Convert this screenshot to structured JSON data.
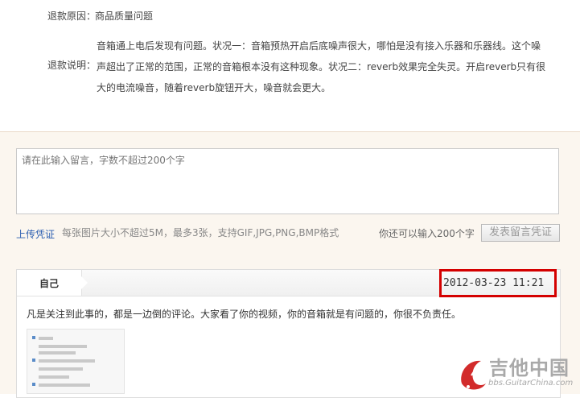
{
  "refund": {
    "reason_label": "退款原因：",
    "reason_value": "商品质量问题",
    "desc_label": "退款说明：",
    "desc_text": "音箱通上电后发现有问题。状况一：音箱预热开启后底噪声很大，哪怕是没有接入乐器和乐器线。这个噪声超出了正常的范围，正常的音箱根本没有这种现象。状况二：reverb效果完全失灵。开启reverb只有很大的电流噪音，随着reverb旋钮开大，噪音就会更大。"
  },
  "message": {
    "placeholder": "请在此输入留言，字数不超过200个字",
    "upload_link": "上传凭证",
    "upload_hint": "每张图片大小不超过5M，最多3张，支持GIF,JPG,PNG,BMP格式",
    "remaining": "你还可以输入200个字",
    "submit_label": "发表留言凭证"
  },
  "comment": {
    "author": "自己",
    "timestamp": "2012-03-23  11:21",
    "text": "凡是关注到此事的，都是一边倒的评论。大家看了你的视频，你的音箱就是有问题的，你很不负责任。"
  },
  "watermark": {
    "title": "吉他中国",
    "site": "bbs.GuitarChina.com"
  },
  "colors": {
    "highlight": "#d40000",
    "link": "#2a5db0",
    "panel_bg": "#fbf6ef"
  }
}
